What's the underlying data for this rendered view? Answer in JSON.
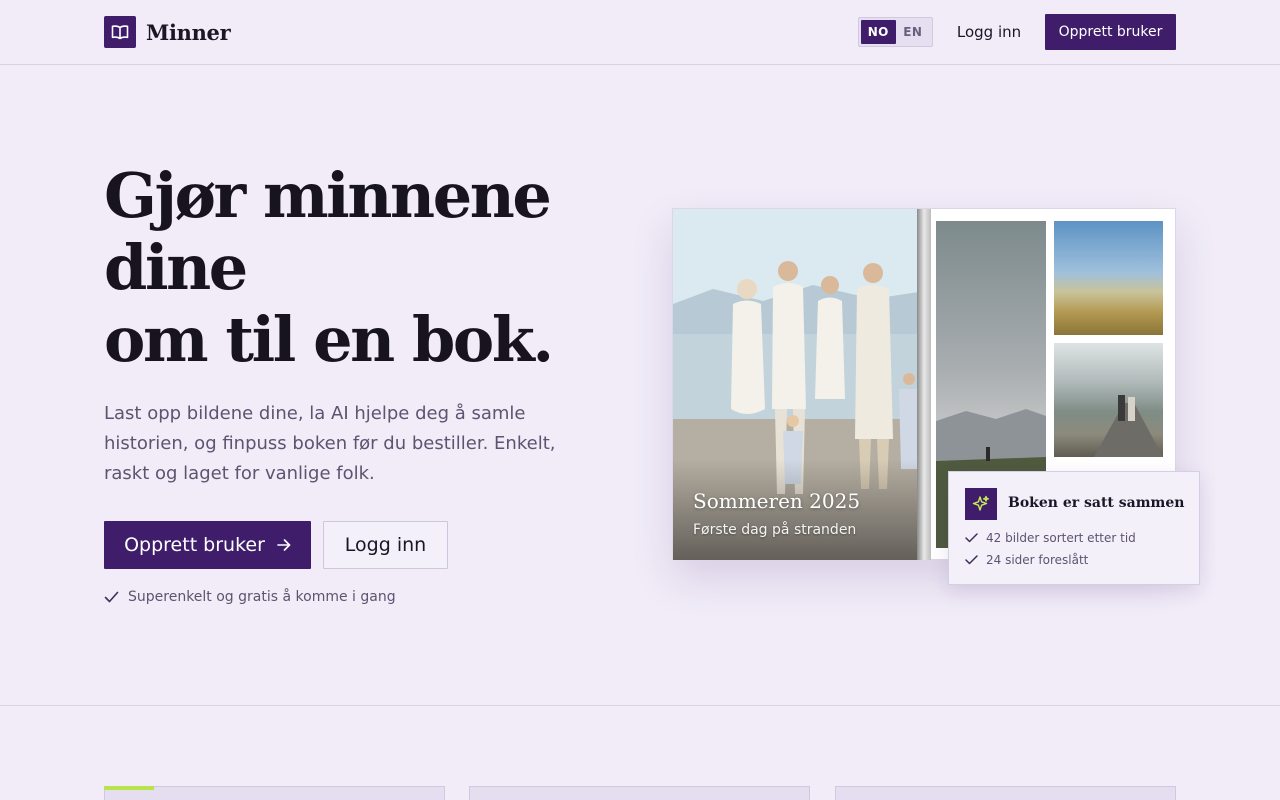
{
  "header": {
    "brand": "Minner",
    "lang_options": [
      "NO",
      "EN"
    ],
    "active_lang": "NO",
    "login_label": "Logg inn",
    "signup_label": "Opprett bruker"
  },
  "hero": {
    "title_line1": "Gjør minnene",
    "title_line2": "dine",
    "title_line3": "om til en bok.",
    "subtitle": "Last opp bildene dine, la AI hjelpe deg å samle historien, og finpuss boken før du bestiller. Enkelt, raskt og laget for vanlige folk.",
    "primary_cta": "Opprett bruker",
    "secondary_cta": "Logg inn",
    "note": "Superenkelt og gratis å komme i gang"
  },
  "preview": {
    "cover_title": "Sommeren 2025",
    "cover_subtitle": "Første dag på stranden",
    "toast_title": "Boken er satt sammen",
    "toast_items": [
      "42 bilder sortert etter tid",
      "24 sider foreslått"
    ]
  },
  "colors": {
    "background": "#f1ecf8",
    "brand": "#3f1d6b",
    "accent": "#b9e34a"
  },
  "icons": {
    "logo": "open-book-icon",
    "cta_arrow": "arrow-right-icon",
    "check": "check-icon",
    "toast": "sparkle-icon"
  }
}
